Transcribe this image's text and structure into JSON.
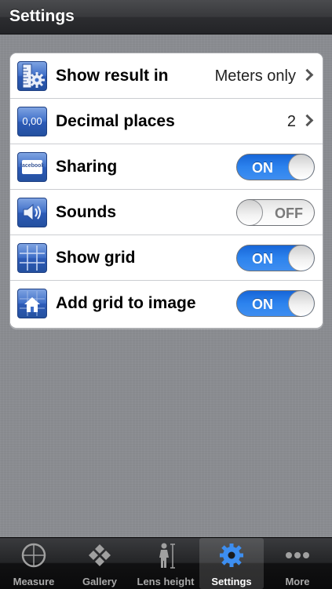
{
  "navbar": {
    "title": "Settings"
  },
  "settings": {
    "rows": [
      {
        "label": "Show result in",
        "value": "Meters only",
        "icon": "ruler-gear-icon"
      },
      {
        "label": "Decimal places",
        "value": "2",
        "icon": "decimal-icon",
        "icon_text": "0,00"
      },
      {
        "label": "Sharing",
        "toggle": "ON",
        "icon": "facebook-icon",
        "icon_text": "facebook"
      },
      {
        "label": "Sounds",
        "toggle": "OFF",
        "icon": "speaker-icon"
      },
      {
        "label": "Show grid",
        "toggle": "ON",
        "icon": "grid-icon"
      },
      {
        "label": "Add grid to image",
        "toggle": "ON",
        "icon": "house-grid-icon"
      }
    ]
  },
  "tabbar": {
    "selected": "Settings",
    "tabs": [
      {
        "label": "Measure",
        "icon": "crosshair-icon"
      },
      {
        "label": "Gallery",
        "icon": "gallery-diamonds-icon"
      },
      {
        "label": "Lens height",
        "icon": "person-height-icon"
      },
      {
        "label": "Settings",
        "icon": "gear-icon"
      },
      {
        "label": "More",
        "icon": "more-dots-icon"
      }
    ]
  },
  "colors": {
    "toggle_on": "#2c83ee",
    "icon_blue": "#3f6fc8",
    "navbar": "#2c2d30",
    "background": "#8a8c91"
  }
}
